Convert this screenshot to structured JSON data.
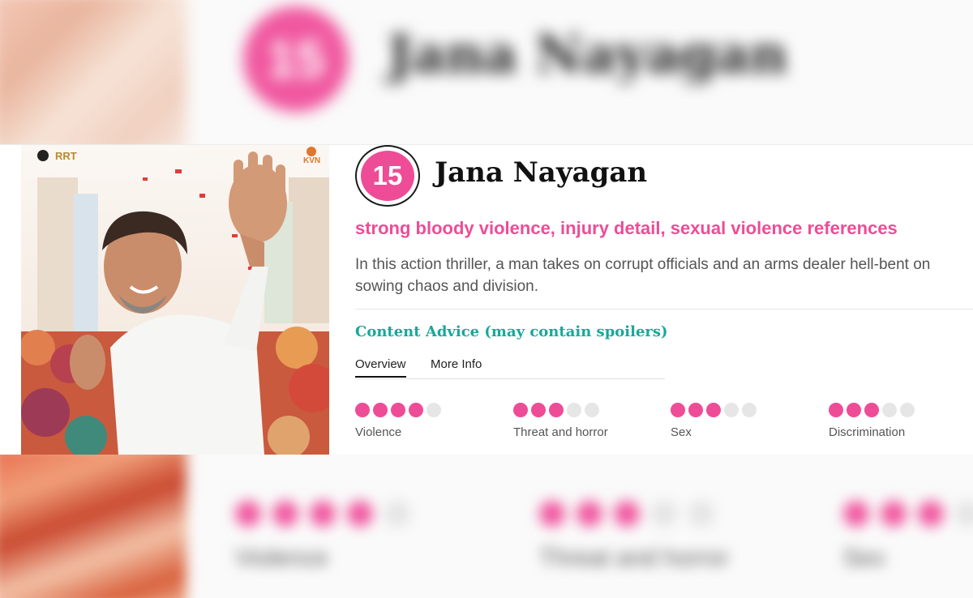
{
  "film": {
    "rating": "15",
    "title": "Jana Nayagan",
    "short_advice": "strong bloody violence, injury detail, sexual violence references",
    "synopsis": "In this action thriller, a man takes on corrupt officials and an arms dealer hell-bent on sowing chaos and division."
  },
  "content_advice": {
    "heading": "Content Advice (may contain spoilers)",
    "tabs": [
      {
        "label": "Overview",
        "active": true
      },
      {
        "label": "More Info",
        "active": false
      }
    ],
    "categories": [
      {
        "label": "Violence",
        "level": 4,
        "max": 5
      },
      {
        "label": "Threat and horror",
        "level": 3,
        "max": 5
      },
      {
        "label": "Sex",
        "level": 3,
        "max": 5
      },
      {
        "label": "Discrimination",
        "level": 3,
        "max": 5
      }
    ]
  },
  "poster": {
    "logo_left": "RRT",
    "logo_right": "KVN"
  },
  "colors": {
    "accent_pink": "#ee4c97",
    "advice_teal": "#1aa79a",
    "dot_inactive": "#e6e6e6"
  }
}
